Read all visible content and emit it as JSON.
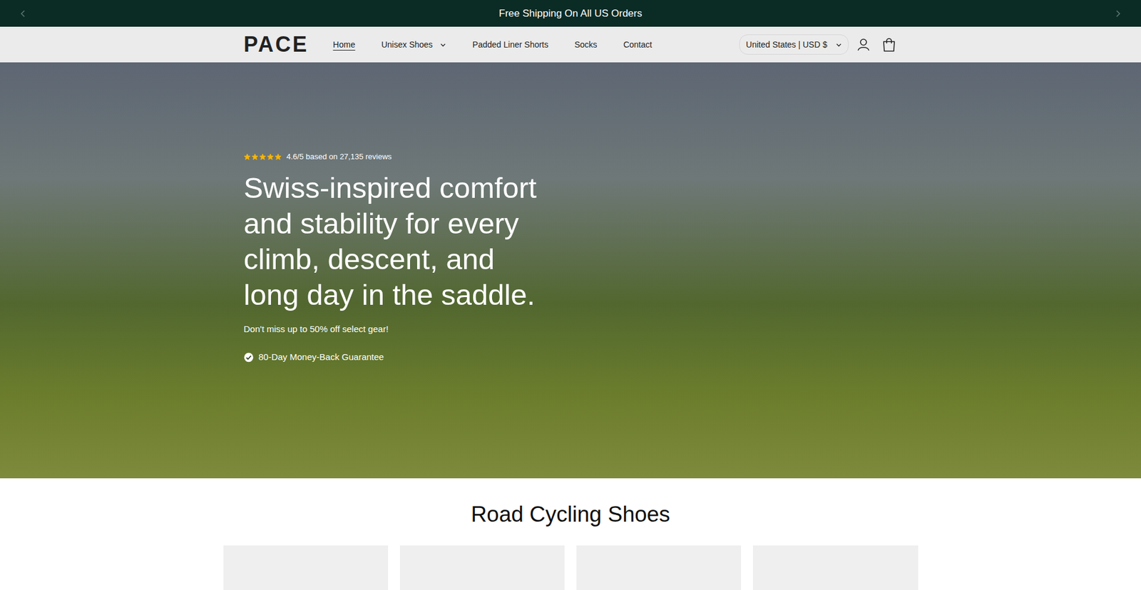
{
  "announcement": {
    "text": "Free Shipping On All US Orders"
  },
  "header": {
    "logo": "PACE",
    "nav": [
      {
        "label": "Home",
        "selected": true,
        "has_dropdown": false
      },
      {
        "label": "Unisex Shoes",
        "selected": false,
        "has_dropdown": true
      },
      {
        "label": "Padded Liner Shorts",
        "selected": false,
        "has_dropdown": false
      },
      {
        "label": "Socks",
        "selected": false,
        "has_dropdown": false
      },
      {
        "label": "Contact",
        "selected": false,
        "has_dropdown": false
      }
    ],
    "country_selector": "United States | USD $"
  },
  "hero": {
    "stars": 5,
    "rating_text": "4.6/5 based on 27,135 reviews",
    "heading": "Swiss-inspired comfort and stability for every climb, descent, and long day in the saddle.",
    "subtext": "Don't miss up to 50% off select gear!",
    "guarantee": "80-Day Money-Back Guarantee"
  },
  "section": {
    "title": "Road Cycling Shoes",
    "cards": [
      {},
      {},
      {},
      {}
    ]
  }
}
